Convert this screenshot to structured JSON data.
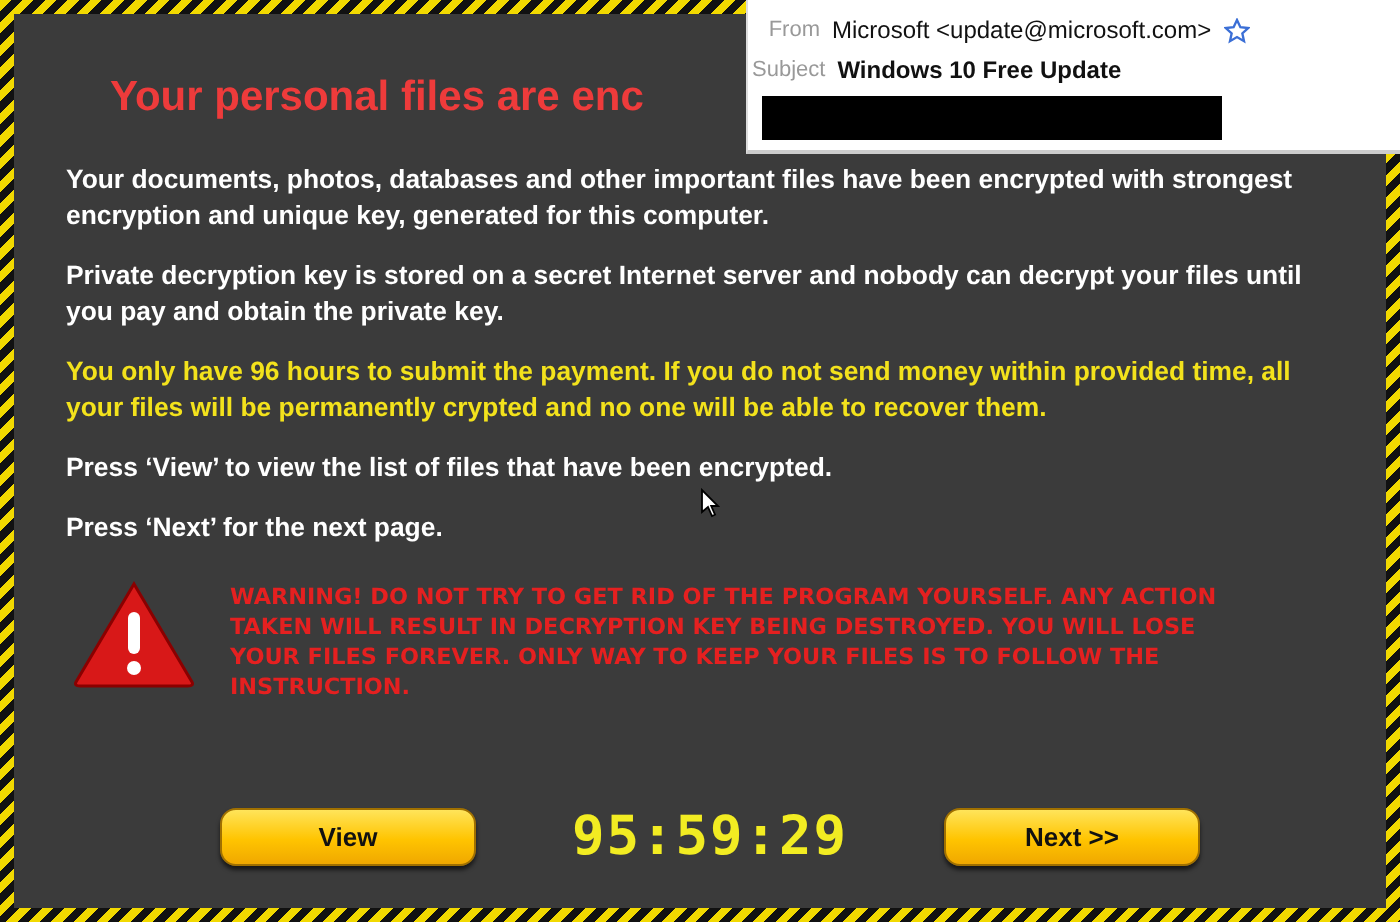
{
  "title": "Your personal files are enc",
  "paragraphs": [
    {
      "text": "Your documents, photos, databases and other important files have been encrypted with strongest encryption and unique key, generated for this computer.",
      "kind": "normal"
    },
    {
      "text": "Private decryption key is stored on a secret Internet server and nobody can decrypt your files until you pay and obtain the private key.",
      "kind": "normal"
    },
    {
      "text": "You only have 96 hours to submit the payment. If you do not send money within provided time, all your files will be permanently crypted and no one will be able to recover them.",
      "kind": "alert"
    },
    {
      "text": "Press ‘View’ to view the list of files that have been encrypted.",
      "kind": "normal"
    },
    {
      "text": "Press ‘Next’ for the next page.",
      "kind": "normal"
    }
  ],
  "warning": "WARNING! DO NOT TRY TO GET RID OF THE PROGRAM YOURSELF. ANY ACTION TAKEN WILL RESULT IN DECRYPTION KEY BEING DESTROYED. YOU WILL LOSE YOUR FILES FOREVER. ONLY WAY TO KEEP YOUR FILES IS TO FOLLOW THE INSTRUCTION.",
  "buttons": [
    "View",
    "Next >>"
  ],
  "timer": "95:59:29",
  "email": {
    "from_label": "From",
    "from": "Microsoft <update@microsoft.com>",
    "subject_label": "Subject",
    "subject": "Windows 10 Free Update"
  }
}
